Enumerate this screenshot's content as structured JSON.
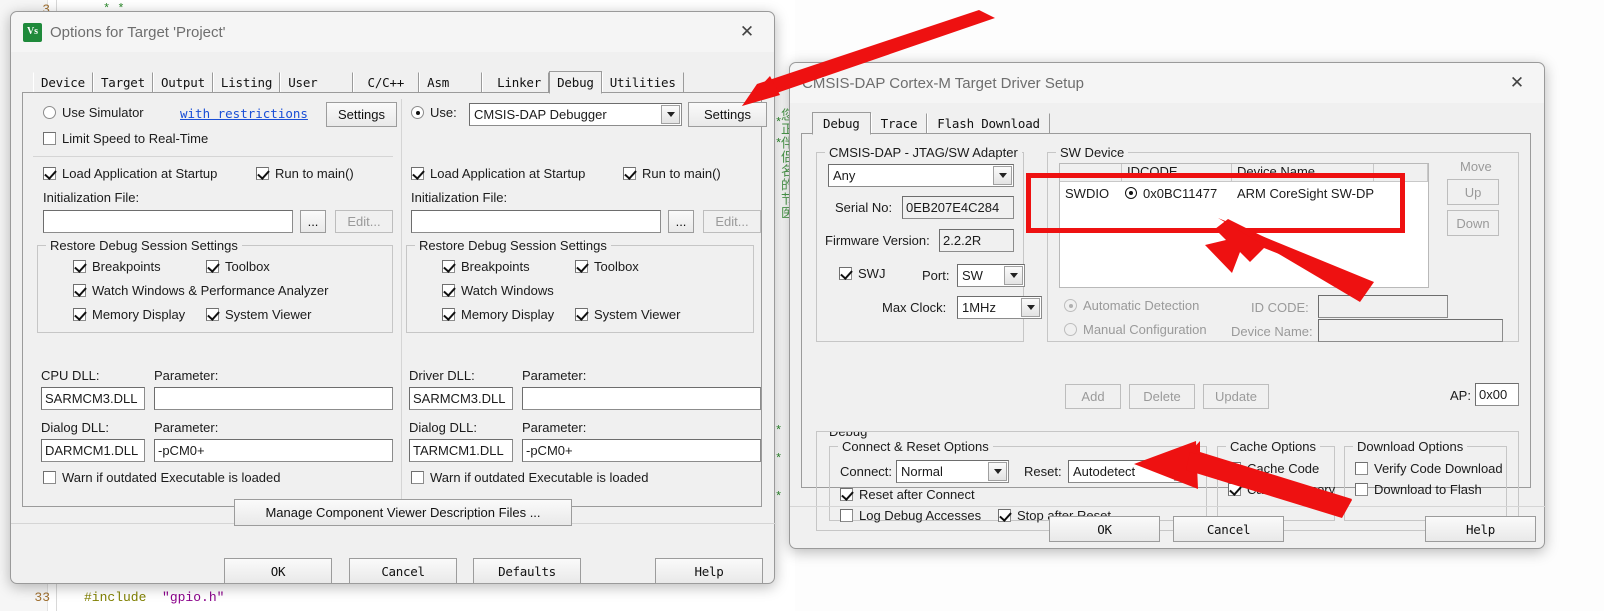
{
  "background": {
    "line_numbers": [
      "3",
      "33"
    ],
    "code_line_33": "#include \"gpio.h\"",
    "code_line_33_kw": "#include",
    "code_line_33_str": "\"gpio.h\"",
    "stars": "* *",
    "vertical_text": "您正伴侣名的节医",
    "star_marks": [
      "*",
      "*",
      "*",
      "*",
      "*"
    ]
  },
  "options_dialog": {
    "title": "Options for Target 'Project'",
    "logo_text": "Vs",
    "close_icon": "close-icon",
    "tabs": [
      {
        "label": "Device",
        "active": false
      },
      {
        "label": "Target",
        "active": false
      },
      {
        "label": "Output",
        "active": false
      },
      {
        "label": "Listing",
        "active": false
      },
      {
        "label": "User",
        "active": false
      },
      {
        "label": "C/C++",
        "active": false
      },
      {
        "label": "Asm",
        "active": false
      },
      {
        "label": "Linker",
        "active": false
      },
      {
        "label": "Debug",
        "active": true
      },
      {
        "label": "Utilities",
        "active": false
      }
    ],
    "left": {
      "use_simulator": {
        "label": "Use Simulator",
        "selected": false
      },
      "with_restrictions": "with restrictions",
      "settings_button": "Settings",
      "limit_speed": {
        "label": "Limit Speed to Real-Time",
        "checked": false
      },
      "load_app": {
        "label": "Load Application at Startup",
        "checked": true
      },
      "run_to_main": {
        "label": "Run to main()",
        "checked": true
      },
      "init_file_label": "Initialization File:",
      "init_file_value": "",
      "browse_button": "...",
      "edit_button": "Edit...",
      "restore_group": "Restore Debug Session Settings",
      "restore_items": [
        {
          "label": "Breakpoints",
          "checked": true
        },
        {
          "label": "Toolbox",
          "checked": true
        },
        {
          "label": "Watch Windows & Performance Analyzer",
          "checked": true
        },
        {
          "label": "Memory Display",
          "checked": true
        },
        {
          "label": "System Viewer",
          "checked": true
        }
      ],
      "cpu_dll_label": "CPU DLL:",
      "cpu_dll_value": "SARMCM3.DLL",
      "cpu_param_label": "Parameter:",
      "cpu_param_value": "",
      "dialog_dll_label": "Dialog DLL:",
      "dialog_dll_value": "DARMCM1.DLL",
      "dialog_param_label": "Parameter:",
      "dialog_param_value": "-pCM0+",
      "warn_outdated": {
        "label": "Warn if outdated Executable is loaded",
        "checked": false
      }
    },
    "right": {
      "use_radio": {
        "label": "Use:",
        "selected": true
      },
      "debugger": "CMSIS-DAP Debugger",
      "settings_button": "Settings",
      "load_app": {
        "label": "Load Application at Startup",
        "checked": true
      },
      "run_to_main": {
        "label": "Run to main()",
        "checked": true
      },
      "init_file_label": "Initialization File:",
      "init_file_value": "",
      "browse_button": "...",
      "edit_button": "Edit...",
      "restore_group": "Restore Debug Session Settings",
      "restore_items": [
        {
          "label": "Breakpoints",
          "checked": true
        },
        {
          "label": "Toolbox",
          "checked": true
        },
        {
          "label": "Watch Windows",
          "checked": true
        },
        {
          "label": "Memory Display",
          "checked": true
        },
        {
          "label": "System Viewer",
          "checked": true
        }
      ],
      "driver_dll_label": "Driver DLL:",
      "driver_dll_value": "SARMCM3.DLL",
      "driver_param_label": "Parameter:",
      "driver_param_value": "",
      "dialog_dll_label": "Dialog DLL:",
      "dialog_dll_value": "TARMCM1.DLL",
      "dialog_param_label": "Parameter:",
      "dialog_param_value": "-pCM0+",
      "warn_outdated": {
        "label": "Warn if outdated Executable is loaded",
        "checked": false
      }
    },
    "manage_button": "Manage Component Viewer Description Files ...",
    "footer": {
      "ok": "OK",
      "cancel": "Cancel",
      "defaults": "Defaults",
      "help": "Help"
    }
  },
  "driver_dialog": {
    "title": "CMSIS-DAP Cortex-M Target Driver Setup",
    "close_icon": "close-icon",
    "tabs": [
      {
        "label": "Debug",
        "active": true
      },
      {
        "label": "Trace",
        "active": false
      },
      {
        "label": "Flash Download",
        "active": false
      }
    ],
    "adapter": {
      "group": "CMSIS-DAP - JTAG/SW Adapter",
      "selected": "Any",
      "serial_label": "Serial No:",
      "serial_value": "0EB207E4C284",
      "firmware_label": "Firmware Version:",
      "firmware_value": "2.2.2R",
      "swj": {
        "label": "SWJ",
        "checked": true
      },
      "port_label": "Port:",
      "port_value": "SW",
      "max_clock_label": "Max Clock:",
      "max_clock_value": "1MHz"
    },
    "sw_device": {
      "group": "SW Device",
      "columns": [
        "IDCODE",
        "Device Name",
        ""
      ],
      "rows": [
        {
          "line": "SWDIO",
          "idcode": "0x0BC11477",
          "device_name": "ARM CoreSight SW-DP"
        }
      ],
      "move_label": "Move",
      "up_button": "Up",
      "down_button": "Down",
      "automatic_detection": {
        "label": "Automatic Detection",
        "selected": true
      },
      "manual_configuration": {
        "label": "Manual Configuration",
        "selected": false
      },
      "id_code_label": "ID CODE:",
      "id_code_value": "",
      "device_name_label": "Device Name:",
      "device_name_value": "",
      "add_button": "Add",
      "delete_button": "Delete",
      "update_button": "Update",
      "ap_label": "AP:",
      "ap_value": "0x00"
    },
    "debug": {
      "group": "Debug",
      "connect_reset_group": "Connect & Reset Options",
      "connect_label": "Connect:",
      "connect_value": "Normal",
      "reset_label": "Reset:",
      "reset_value": "Autodetect",
      "reset_after_connect": {
        "label": "Reset after Connect",
        "checked": true
      },
      "log_debug_accesses": {
        "label": "Log Debug Accesses",
        "checked": false
      },
      "stop_after_reset": {
        "label": "Stop after Reset",
        "checked": true
      },
      "cache_group": "Cache Options",
      "cache_code": {
        "label": "Cache Code",
        "checked": true
      },
      "cache_memory": {
        "label": "Cache Memory",
        "checked": true
      },
      "download_group": "Download Options",
      "verify_code_download": {
        "label": "Verify Code Download",
        "checked": false
      },
      "download_to_flash": {
        "label": "Download to Flash",
        "checked": false
      }
    },
    "footer": {
      "ok": "OK",
      "cancel": "Cancel",
      "help": "Help"
    }
  },
  "annotations": {
    "highlight_color": "#ee1111",
    "arrows": [
      {
        "name": "arrow-to-settings-button"
      },
      {
        "name": "arrow-to-sw-device-row"
      },
      {
        "name": "arrow-to-stop-after-reset"
      }
    ],
    "rectangles": [
      {
        "name": "highlight-sw-device-row"
      }
    ]
  }
}
